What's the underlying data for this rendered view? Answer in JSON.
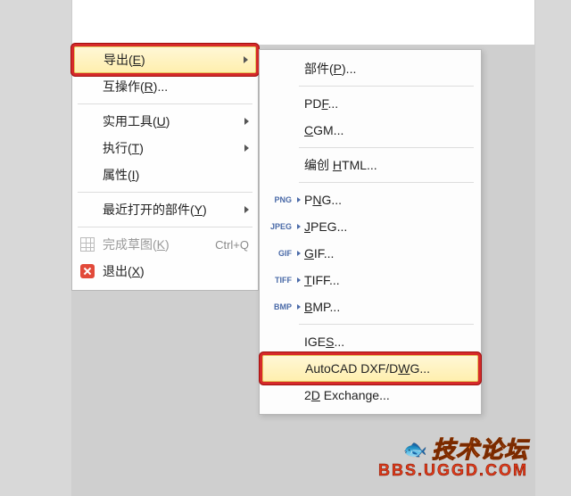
{
  "mainMenu": {
    "export": {
      "label": "导出(",
      "mn": "E",
      "tail": ")"
    },
    "interop": {
      "label": "互操作(",
      "mn": "R",
      "tail": ")..."
    },
    "utilities": {
      "label": "实用工具(",
      "mn": "U",
      "tail": ")"
    },
    "execute": {
      "label": "执行(",
      "mn": "T",
      "tail": ")"
    },
    "properties": {
      "label": "属性(",
      "mn": "I",
      "tail": ")"
    },
    "recent": {
      "label": "最近打开的部件(",
      "mn": "Y",
      "tail": ")"
    },
    "finishSketch": {
      "label": "完成草图(",
      "mn": "K",
      "tail": ")",
      "shortcut": "Ctrl+Q"
    },
    "exit": {
      "label": "退出(",
      "mn": "X",
      "tail": ")"
    }
  },
  "exportMenu": {
    "part": {
      "label": "部件(",
      "mn": "P",
      "tail": ")..."
    },
    "pdf": {
      "label": "PD",
      "mn": "F",
      "tail": "..."
    },
    "cgm": {
      "mn": "C",
      "label": "GM..."
    },
    "html": {
      "label": "编创 ",
      "mn": "H",
      "tail": "TML..."
    },
    "png": {
      "icon": "PNG",
      "label": "P",
      "mn": "N",
      "tail": "G..."
    },
    "jpeg": {
      "icon": "JPEG",
      "mn": "J",
      "label": "PEG..."
    },
    "gif": {
      "icon": "GIF",
      "mn": "G",
      "label": "IF..."
    },
    "tiff": {
      "icon": "TIFF",
      "mn": "T",
      "label": "IFF..."
    },
    "bmp": {
      "icon": "BMP",
      "mn": "B",
      "label": "MP..."
    },
    "iges": {
      "label": "IGE",
      "mn": "S",
      "tail": "..."
    },
    "dxf": {
      "label": "AutoCAD DXF/D",
      "mn": "W",
      "tail": "G..."
    },
    "exchange": {
      "label": "2",
      "mn": "D",
      "tail": " Exchange..."
    }
  },
  "watermark": {
    "line1": "技术论坛",
    "line2": "BBS.UGGD.COM"
  }
}
